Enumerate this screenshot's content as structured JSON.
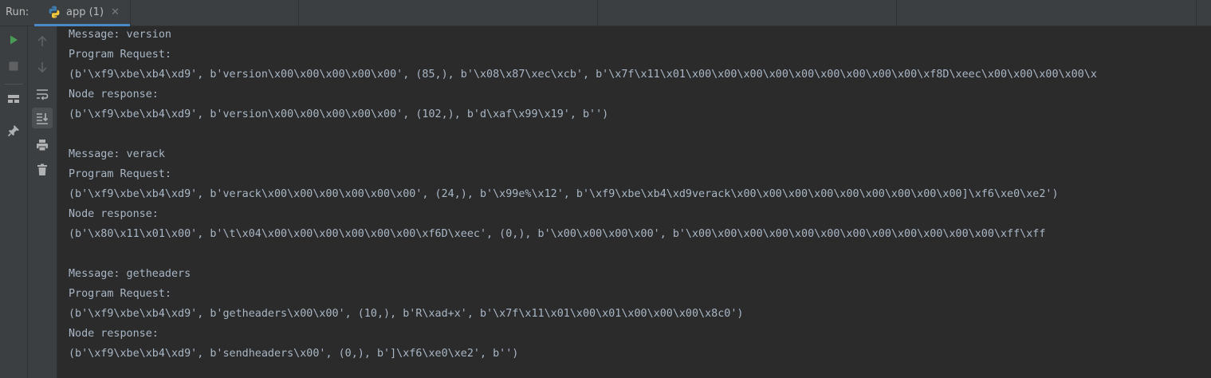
{
  "header": {
    "run_label": "Run:",
    "tab": {
      "label": "app (1)",
      "icon": "python-icon",
      "close": "✕"
    }
  },
  "toolbar_left": [
    {
      "icon": "run-icon",
      "color": "#499c54"
    },
    {
      "icon": "stop-icon",
      "color": "#5f6163"
    },
    {
      "icon": "layout-icon",
      "color": "#afb1b3"
    },
    {
      "icon": "pin-icon",
      "color": "#afb1b3"
    }
  ],
  "toolbar_right": [
    {
      "icon": "arrow-up-icon"
    },
    {
      "icon": "arrow-down-icon"
    },
    {
      "icon": "soft-wrap-icon"
    },
    {
      "icon": "scroll-to-end-icon",
      "active": true
    },
    {
      "icon": "print-icon"
    },
    {
      "icon": "trash-icon"
    }
  ],
  "console": {
    "lines": [
      "Message: version",
      "Program Request:",
      "(b'\\xf9\\xbe\\xb4\\xd9', b'version\\x00\\x00\\x00\\x00\\x00', (85,), b'\\x08\\x87\\xec\\xcb', b'\\x7f\\x11\\x01\\x00\\x00\\x00\\x00\\x00\\x00\\x00\\x00\\x00\\xf8D\\xeec\\x00\\x00\\x00\\x00\\x",
      "Node response:",
      "(b'\\xf9\\xbe\\xb4\\xd9', b'version\\x00\\x00\\x00\\x00\\x00', (102,), b'd\\xaf\\x99\\x19', b'')",
      "",
      "Message: verack",
      "Program Request:",
      "(b'\\xf9\\xbe\\xb4\\xd9', b'verack\\x00\\x00\\x00\\x00\\x00\\x00', (24,), b'\\x99e%\\x12', b'\\xf9\\xbe\\xb4\\xd9verack\\x00\\x00\\x00\\x00\\x00\\x00\\x00\\x00\\x00]\\xf6\\xe0\\xe2')",
      "Node response:",
      "(b'\\x80\\x11\\x01\\x00', b'\\t\\x04\\x00\\x00\\x00\\x00\\x00\\x00\\xf6D\\xeec', (0,), b'\\x00\\x00\\x00\\x00', b'\\x00\\x00\\x00\\x00\\x00\\x00\\x00\\x00\\x00\\x00\\x00\\x00\\xff\\xff",
      "",
      "Message: getheaders",
      "Program Request:",
      "(b'\\xf9\\xbe\\xb4\\xd9', b'getheaders\\x00\\x00', (10,), b'R\\xad+x', b'\\x7f\\x11\\x01\\x00\\x01\\x00\\x00\\x00\\x8c0')",
      "Node response:",
      "(b'\\xf9\\xbe\\xb4\\xd9', b'sendheaders\\x00', (0,), b']\\xf6\\xe0\\xe2', b'')"
    ]
  }
}
